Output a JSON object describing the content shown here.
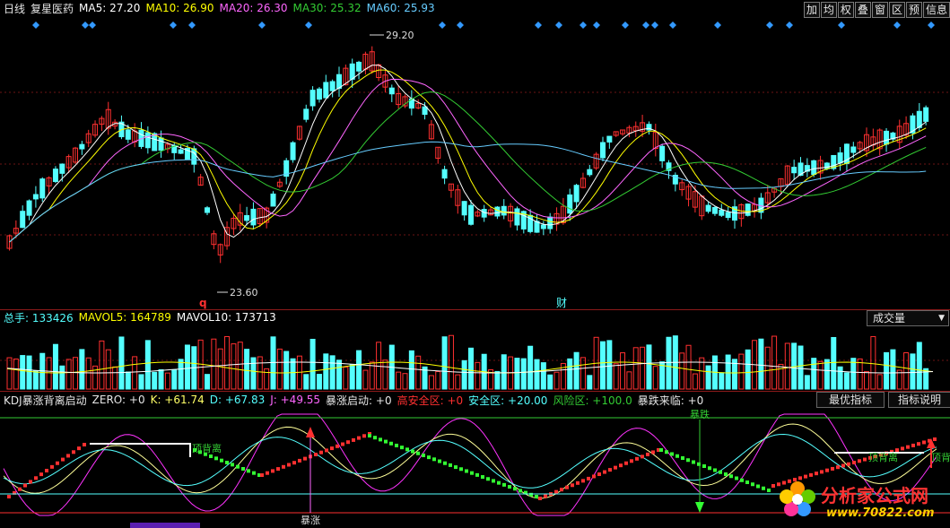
{
  "colors": {
    "up": "#ff3030",
    "down": "#54ffff",
    "bg": "#000000",
    "grid": "#8b1a1a"
  },
  "main": {
    "period": "日线",
    "stock": "复星医药",
    "ma": [
      {
        "label": "MA5: 27.20",
        "color": "#ffffff"
      },
      {
        "label": "MA10: 26.90",
        "color": "#ffff00"
      },
      {
        "label": "MA20: 26.30",
        "color": "#ff66ff"
      },
      {
        "label": "MA30: 25.32",
        "color": "#33cc33"
      },
      {
        "label": "MA60: 25.93",
        "color": "#66ccff"
      }
    ],
    "toolbar": [
      "加",
      "均",
      "权",
      "叠",
      "窗",
      "区",
      "预",
      "信息"
    ],
    "high_label": "29.20",
    "low_label": "23.60",
    "marker_q": "q",
    "marker_cai": "财"
  },
  "volume": {
    "total": "总手: 133426",
    "mavol5": "MAVOL5: 164789",
    "mavol10": "MAVOL10: 173713",
    "dropdown": "成交量"
  },
  "kdj": {
    "title": "KDJ暴涨背离启动",
    "zero": "ZERO: +0",
    "k": "K: +61.74",
    "d": "D: +67.83",
    "j": "J: +49.55",
    "start": "暴涨启动: +0",
    "high_safe": "高安全区: +0",
    "safe": "安全区: +20.00",
    "risk": "风险区: +100.0",
    "crash_coming": "暴跌来临: +0",
    "btn_best": "最优指标",
    "btn_help": "指标说明",
    "lbl_diverge1": "顶背离",
    "lbl_diverge2": "顶背离",
    "lbl_diverge3": "顶背",
    "lbl_surge": "暴涨",
    "lbl_crash": "暴跌"
  },
  "watermark": {
    "title": "分析家公式网",
    "url": "www.70822.com"
  }
}
